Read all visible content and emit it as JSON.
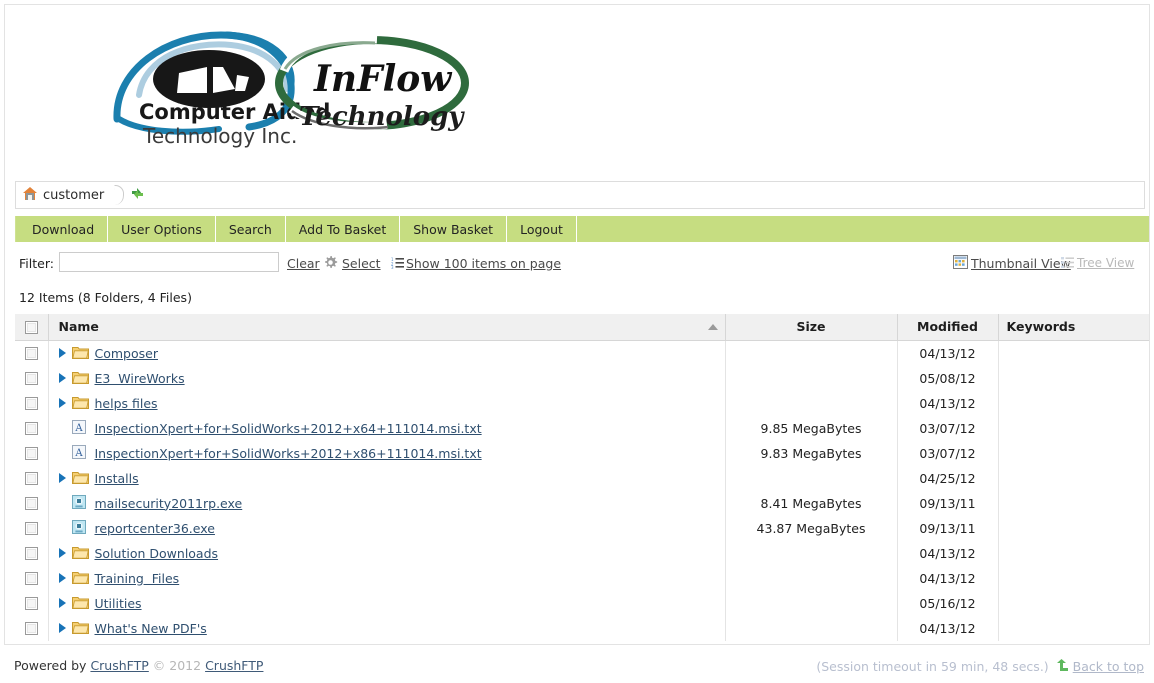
{
  "branding": {
    "logo_text_1": "Computer Aided",
    "logo_text_2": "Technology Inc.",
    "logo_text_3": "InFlow",
    "logo_text_4": "Technology",
    "blue": "#1b7fae",
    "green": "#2f6b3d",
    "toolbar_green": "#c6dd81"
  },
  "breadcrumb": {
    "home_icon": "home-icon",
    "path": "customer",
    "refresh_icon": "refresh-icon"
  },
  "toolbar": {
    "buttons": [
      {
        "label": "Download"
      },
      {
        "label": "User Options"
      },
      {
        "label": "Search"
      },
      {
        "label": "Add To Basket"
      },
      {
        "label": "Show Basket"
      },
      {
        "label": "Logout"
      }
    ]
  },
  "filter": {
    "label": "Filter:",
    "value": "",
    "placeholder": "",
    "clear_label": "Clear",
    "gear_icon": "gear-icon",
    "select_label": "Select",
    "list_icon": "list-icon",
    "show_items_label": "Show 100 items on page",
    "thumbnail_icon": "thumbnail-grid-icon",
    "thumbnail_label": "Thumbnail View",
    "tree_icon": "tree-list-icon",
    "tree_label": "Tree View",
    "tree_disabled": true
  },
  "summary": {
    "text": "12 Items (8 Folders, 4 Files)"
  },
  "table": {
    "columns": [
      {
        "key": "checkbox",
        "label": ""
      },
      {
        "key": "name",
        "label": "Name",
        "sort": "asc"
      },
      {
        "key": "size",
        "label": "Size"
      },
      {
        "key": "modified",
        "label": "Modified"
      },
      {
        "key": "keywords",
        "label": "Keywords"
      }
    ],
    "rows": [
      {
        "name": "Composer",
        "type": "folder",
        "icon": "folder-icon",
        "expandable": true,
        "size": "",
        "modified": "04/13/12",
        "keywords": ""
      },
      {
        "name": "E3  WireWorks",
        "type": "folder",
        "icon": "folder-icon",
        "expandable": true,
        "size": "",
        "modified": "05/08/12",
        "keywords": ""
      },
      {
        "name": "helps files",
        "type": "folder",
        "icon": "folder-icon",
        "expandable": true,
        "size": "",
        "modified": "04/13/12",
        "keywords": ""
      },
      {
        "name": "InspectionXpert+for+SolidWorks+2012+x64+111014.msi.txt",
        "type": "file",
        "icon": "text-file-icon",
        "expandable": false,
        "size": "9.85 MegaBytes",
        "modified": "03/07/12",
        "keywords": ""
      },
      {
        "name": "InspectionXpert+for+SolidWorks+2012+x86+111014.msi.txt",
        "type": "file",
        "icon": "text-file-icon",
        "expandable": false,
        "size": "9.83 MegaBytes",
        "modified": "03/07/12",
        "keywords": ""
      },
      {
        "name": "Installs",
        "type": "folder",
        "icon": "folder-icon",
        "expandable": true,
        "size": "",
        "modified": "04/25/12",
        "keywords": ""
      },
      {
        "name": "mailsecurity2011rp.exe",
        "type": "file",
        "icon": "exe-file-icon",
        "expandable": false,
        "size": "8.41 MegaBytes",
        "modified": "09/13/11",
        "keywords": ""
      },
      {
        "name": "reportcenter36.exe",
        "type": "file",
        "icon": "exe-file-icon",
        "expandable": false,
        "size": "43.87 MegaBytes",
        "modified": "09/13/11",
        "keywords": ""
      },
      {
        "name": "Solution Downloads",
        "type": "folder",
        "icon": "folder-icon",
        "expandable": true,
        "size": "",
        "modified": "04/13/12",
        "keywords": ""
      },
      {
        "name": "Training  Files",
        "type": "folder",
        "icon": "folder-icon",
        "expandable": true,
        "size": "",
        "modified": "04/13/12",
        "keywords": ""
      },
      {
        "name": "Utilities",
        "type": "folder",
        "icon": "folder-icon",
        "expandable": true,
        "size": "",
        "modified": "05/16/12",
        "keywords": ""
      },
      {
        "name": "What's New PDF's",
        "type": "folder",
        "icon": "folder-icon",
        "expandable": true,
        "size": "",
        "modified": "04/13/12",
        "keywords": ""
      }
    ]
  },
  "footer": {
    "powered_by": "Powered by",
    "product_link_1": "CrushFTP",
    "copyright": "© 2012",
    "product_link_2": "CrushFTP",
    "session_timeout": "(Session timeout in 59 min, 48 secs.)",
    "back_to_top": "Back to top",
    "back_to_top_icon": "up-arrow-icon"
  }
}
